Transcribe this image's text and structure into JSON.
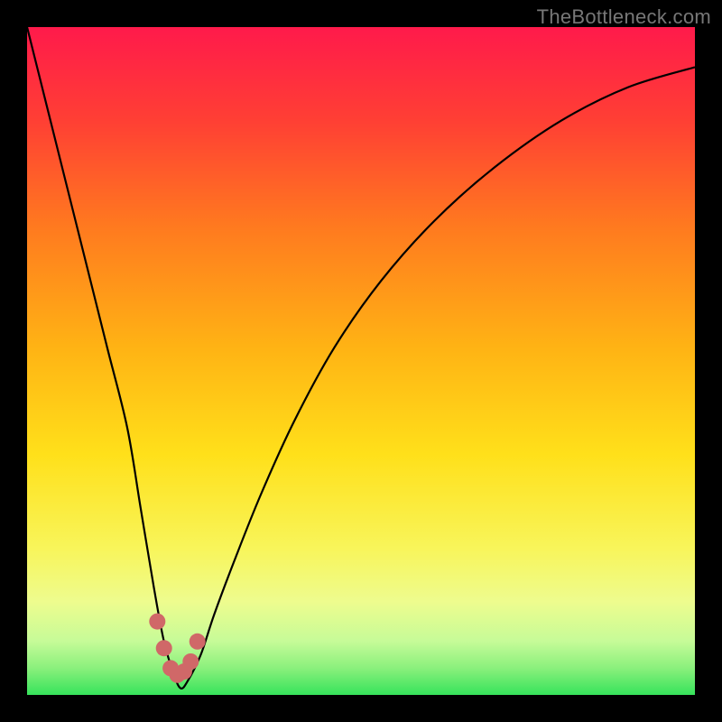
{
  "watermark": "TheBottleneck.com",
  "colors": {
    "frame": "#000000",
    "watermark_text": "#777777",
    "curve": "#000000",
    "marker": "#d06868"
  },
  "chart_data": {
    "type": "line",
    "title": "",
    "xlabel": "",
    "ylabel": "",
    "xlim": [
      0,
      100
    ],
    "ylim": [
      0,
      100
    ],
    "gradient_stops": [
      {
        "pct": 0,
        "color": "#ff1a4b"
      },
      {
        "pct": 14,
        "color": "#ff3f34"
      },
      {
        "pct": 30,
        "color": "#ff7a1f"
      },
      {
        "pct": 48,
        "color": "#ffb314"
      },
      {
        "pct": 64,
        "color": "#ffe01a"
      },
      {
        "pct": 78,
        "color": "#f8f55a"
      },
      {
        "pct": 86,
        "color": "#eefc8e"
      },
      {
        "pct": 92,
        "color": "#c6fb98"
      },
      {
        "pct": 96,
        "color": "#8af07c"
      },
      {
        "pct": 100,
        "color": "#36e35b"
      }
    ],
    "series": [
      {
        "name": "bottleneck-curve",
        "x": [
          0,
          3,
          6,
          9,
          12,
          15,
          17,
          19,
          20.5,
          22,
          23,
          24,
          26,
          28,
          31,
          35,
          40,
          46,
          53,
          61,
          70,
          80,
          90,
          100
        ],
        "y": [
          100,
          88,
          76,
          64,
          52,
          40,
          28,
          16,
          8,
          3,
          1,
          2,
          6,
          12,
          20,
          30,
          41,
          52,
          62,
          71,
          79,
          86,
          91,
          94
        ]
      }
    ],
    "markers": {
      "name": "highlight-near-minimum",
      "x": [
        19.5,
        20.5,
        21.5,
        22.5,
        23.5,
        24.5,
        25.5
      ],
      "y": [
        11,
        7,
        4,
        3,
        3.5,
        5,
        8
      ]
    },
    "minimum": {
      "x": 23,
      "y": 1
    }
  }
}
